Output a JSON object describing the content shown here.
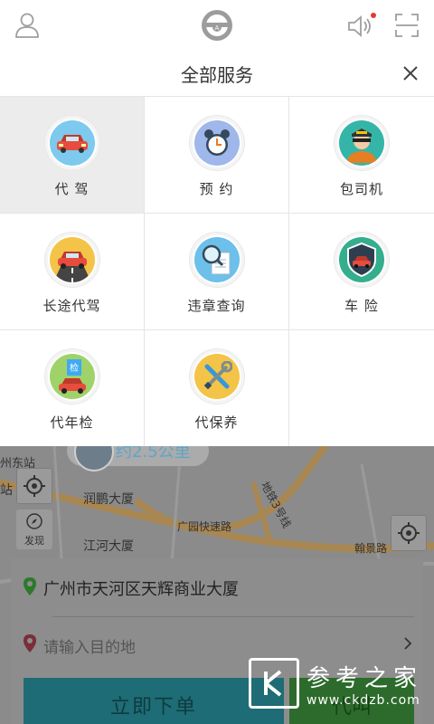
{
  "header": {
    "profile_icon": "user-icon",
    "center_icon": "steering-wheel-icon",
    "sound_icon": "speaker-icon",
    "scan_icon": "scan-icon",
    "notification_dot_color": "#e53935"
  },
  "panel": {
    "title": "全部服务",
    "close_icon": "close-icon",
    "services": [
      {
        "label": "代 驾",
        "icon": "car-icon",
        "color": "#7ec9ee",
        "active": true
      },
      {
        "label": "预 约",
        "icon": "alarm-clock-icon",
        "color": "#9fb7ea",
        "active": false
      },
      {
        "label": "包司机",
        "icon": "chauffeur-icon",
        "color": "#35b5a8",
        "active": false
      },
      {
        "label": "长途代驾",
        "icon": "road-car-icon",
        "color": "#f3c447",
        "active": false
      },
      {
        "label": "违章查询",
        "icon": "magnifier-document-icon",
        "color": "#6cc0ea",
        "active": false
      },
      {
        "label": "车 险",
        "icon": "shield-car-icon",
        "color": "#35ae8d",
        "active": false
      },
      {
        "label": "代年检",
        "icon": "inspection-icon",
        "color": "#9fd36a",
        "active": false
      },
      {
        "label": "代保养",
        "icon": "wrench-screwdriver-icon",
        "color": "#f3c447",
        "active": false
      }
    ]
  },
  "map": {
    "bubble_text": "约2.5公里",
    "locate_icon": "crosshair-icon",
    "discover_label": "发现",
    "discover_icon": "compass-icon",
    "poi_1": "润鹏大厦",
    "poi_2": "江河大厦",
    "road_1": "广园快速路",
    "metro_label": "地铁3号线",
    "road_2": "翰景路",
    "label_left_top": "州东站",
    "label_left_mid": "站"
  },
  "order": {
    "from_address": "广州市天河区天辉商业大厦",
    "to_placeholder": "请输入目的地",
    "go_button": "立即下单",
    "call_button": "代叫"
  },
  "watermark": {
    "cn": "参考之家",
    "url": "www.ckdzb.com"
  }
}
